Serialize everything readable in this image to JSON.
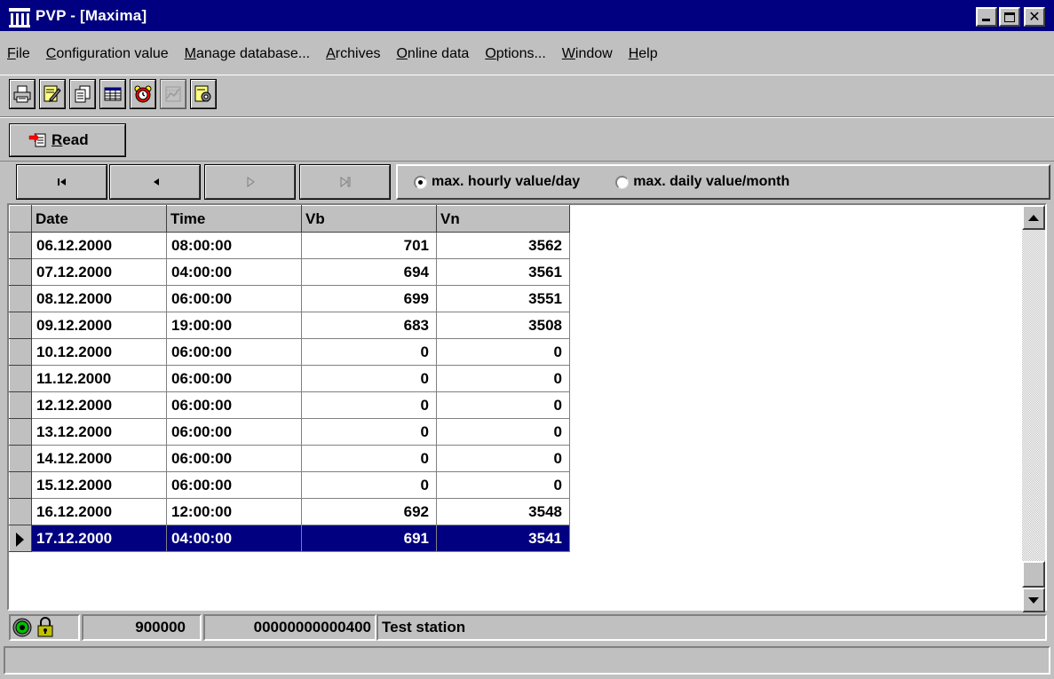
{
  "window": {
    "title": "PVP - [Maxima]"
  },
  "menu": [
    {
      "label": "File",
      "key": "F",
      "rest": "ile"
    },
    {
      "label": "Configuration value",
      "key": "C",
      "rest": "onfiguration value"
    },
    {
      "label": "Manage database...",
      "key": "M",
      "rest": "anage database..."
    },
    {
      "label": "Archives",
      "key": "A",
      "rest": "rchives"
    },
    {
      "label": "Online data",
      "key": "O",
      "rest": "nline data"
    },
    {
      "label": "Options...",
      "key": "O",
      "rest": "ptions..."
    },
    {
      "label": "Window",
      "key": "W",
      "rest": "indow"
    },
    {
      "label": "Help",
      "key": "H",
      "rest": "elp"
    }
  ],
  "toolbar": {
    "icons": [
      "print-icon",
      "edit-config-icon",
      "copy-pages-icon",
      "table-icon",
      "alarm-clock-icon",
      "chart-icon-disabled",
      "settings-document-icon"
    ]
  },
  "read_button": {
    "key": "R",
    "rest": "ead"
  },
  "radio_options": [
    {
      "label": "max. hourly value/day",
      "checked": true
    },
    {
      "label": "max. daily value/month",
      "checked": false
    }
  ],
  "grid": {
    "columns": [
      "Date",
      "Time",
      "Vb",
      "Vn"
    ],
    "rows": [
      [
        "06.12.2000",
        "08:00:00",
        "701",
        "3562"
      ],
      [
        "07.12.2000",
        "04:00:00",
        "694",
        "3561"
      ],
      [
        "08.12.2000",
        "06:00:00",
        "699",
        "3551"
      ],
      [
        "09.12.2000",
        "19:00:00",
        "683",
        "3508"
      ],
      [
        "10.12.2000",
        "06:00:00",
        "0",
        "0"
      ],
      [
        "11.12.2000",
        "06:00:00",
        "0",
        "0"
      ],
      [
        "12.12.2000",
        "06:00:00",
        "0",
        "0"
      ],
      [
        "13.12.2000",
        "06:00:00",
        "0",
        "0"
      ],
      [
        "14.12.2000",
        "06:00:00",
        "0",
        "0"
      ],
      [
        "15.12.2000",
        "06:00:00",
        "0",
        "0"
      ],
      [
        "16.12.2000",
        "12:00:00",
        "692",
        "3548"
      ],
      [
        "17.12.2000",
        "04:00:00",
        "691",
        "3541"
      ]
    ],
    "selected_row": 11
  },
  "status": {
    "number": "900000",
    "id": "00000000000400",
    "station": "Test station"
  },
  "colors": {
    "titlebar": "#000080",
    "selection": "#000080",
    "face": "#c0c0c0"
  }
}
